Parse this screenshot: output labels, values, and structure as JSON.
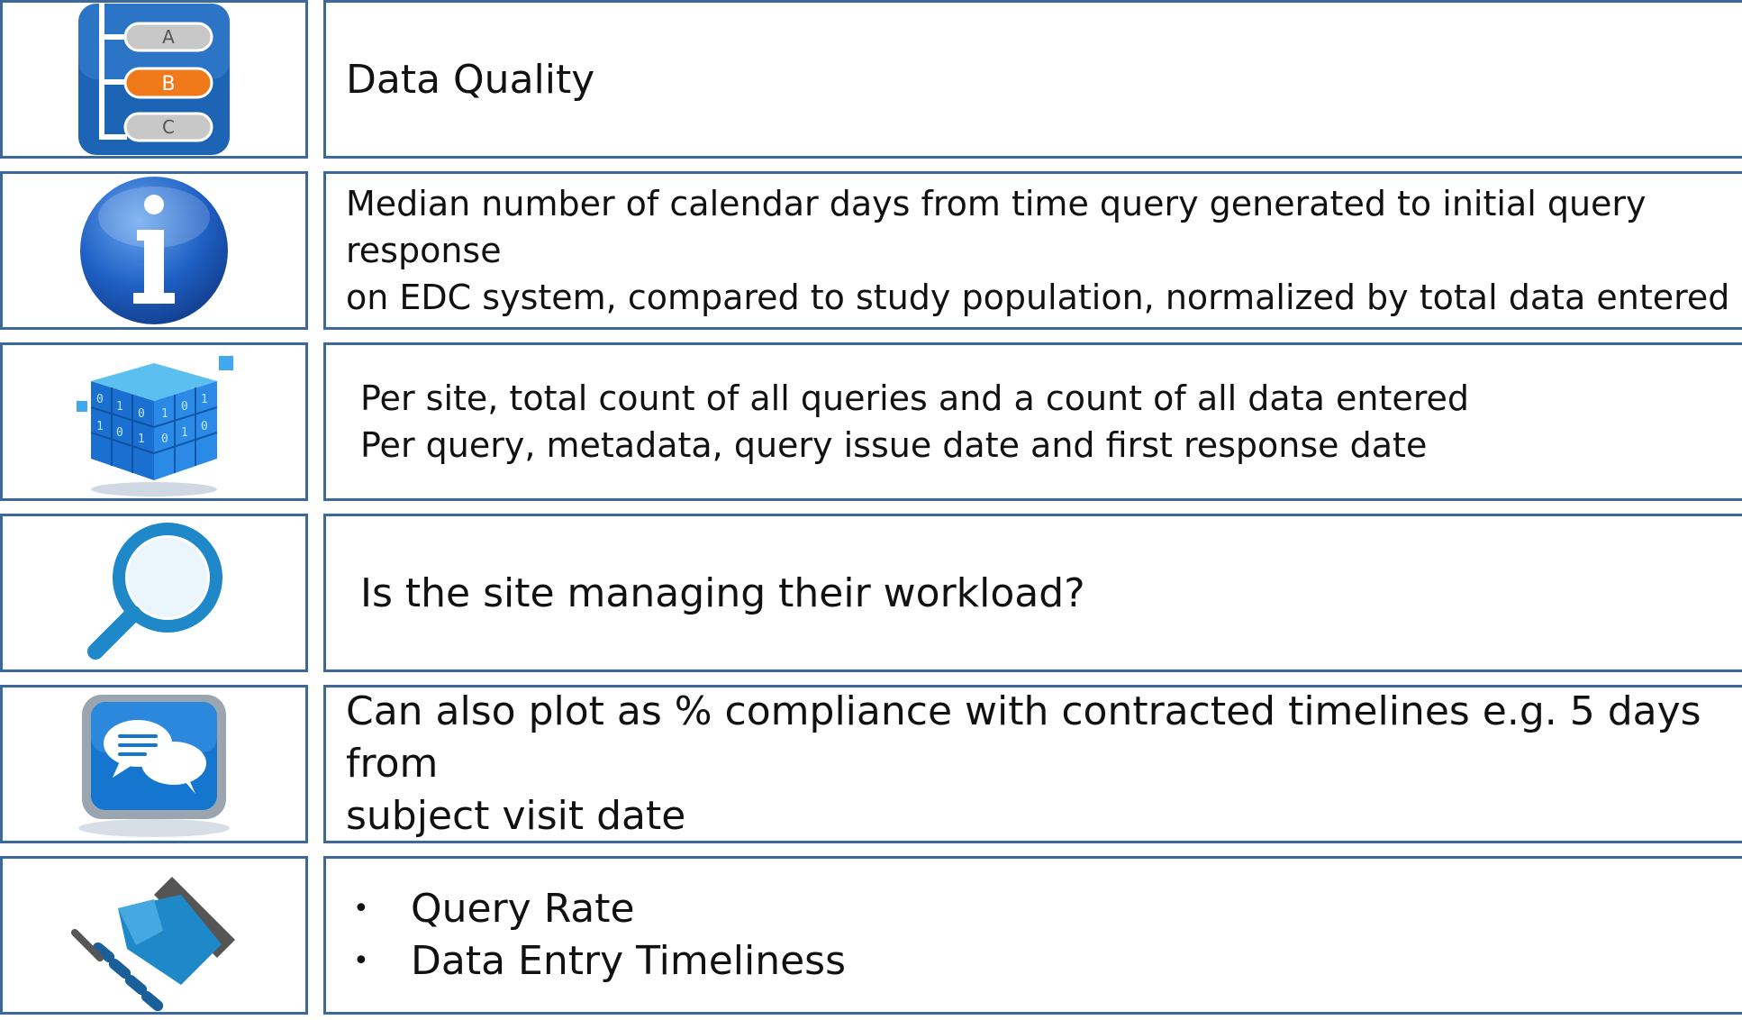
{
  "rows": [
    {
      "icon": "abc-list-icon",
      "lines": [
        "Data Quality"
      ]
    },
    {
      "icon": "info-icon",
      "lines": [
        "Median number of calendar days from time query generated to initial query response",
        "on EDC system, compared to study population, normalized by total data entered"
      ]
    },
    {
      "icon": "binary-data-cube-icon",
      "lines": [
        "Per site, total count of all queries and a count of all data entered",
        "Per query, metadata, query issue date and first response date"
      ]
    },
    {
      "icon": "magnifier-icon",
      "lines": [
        "Is the site managing their workload?"
      ]
    },
    {
      "icon": "chat-bubbles-icon",
      "lines": [
        "Can also plot as % compliance with contracted timelines e.g. 5 days from",
        "subject visit date"
      ]
    },
    {
      "icon": "handshake-icon",
      "bullets": [
        "Query Rate",
        "Data Entry Timeliness"
      ],
      "bullet_glyph": "•"
    }
  ],
  "icon_letters": [
    "A",
    "B",
    "C"
  ],
  "colors": {
    "border": "#3b6a9a",
    "icon_blue": "#1e64b4",
    "icon_orange": "#f07a1a",
    "icon_gray": "#c8c8c8"
  }
}
